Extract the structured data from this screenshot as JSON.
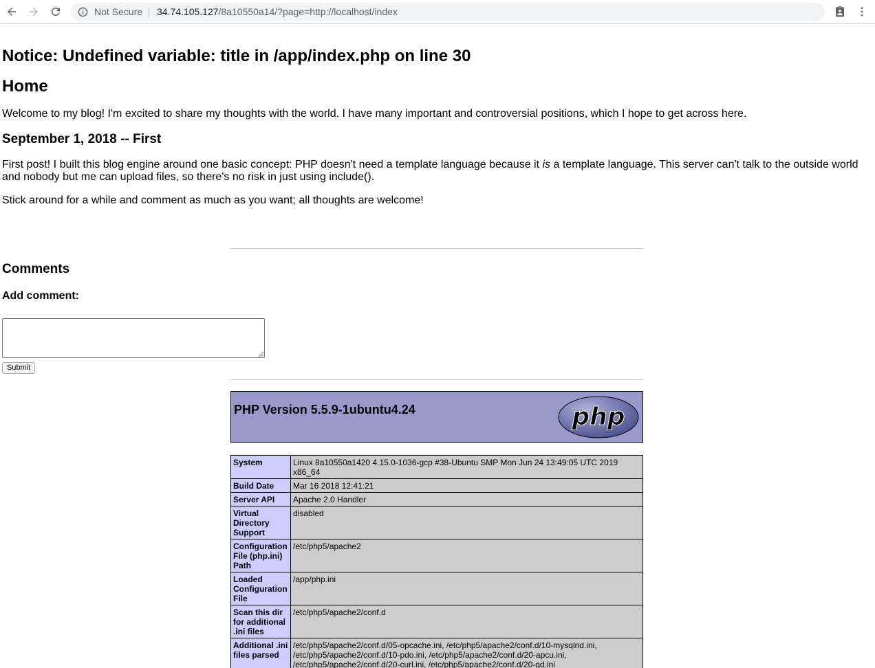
{
  "browser": {
    "security_label": "Not Secure",
    "url_host": "34.74.105.127",
    "url_path": "/8a10550a14/?page=http://localhost/index"
  },
  "page": {
    "notice": "Notice: Undefined variable: title in /app/index.php on line 30",
    "heading": "Home",
    "intro": "Welcome to my blog! I'm excited to share my thoughts with the world. I have many important and controversial positions, which I hope to get across here.",
    "post_title": "September 1, 2018 -- First",
    "post_body_before": "First post! I built this blog engine around one basic concept: PHP doesn't need a template language because it ",
    "post_body_em": "is",
    "post_body_after": " a template language. This server can't talk to the outside world and nobody but me can upload files, so there's no risk in just using include().",
    "post_body_2": "Stick around for a while and comment as much as you want; all thoughts are welcome!",
    "comments_heading": "Comments",
    "add_comment_label": "Add comment:",
    "comment_value": "",
    "submit_label": "Submit"
  },
  "phpinfo": {
    "version": "PHP Version 5.5.9-1ubuntu4.24",
    "logo_text": "php",
    "rows": [
      {
        "key": "System",
        "value": "Linux 8a10550a1420 4.15.0-1036-gcp #38-Ubuntu SMP Mon Jun 24 13:49:05 UTC 2019 x86_64"
      },
      {
        "key": "Build Date",
        "value": "Mar 16 2018 12:41:21"
      },
      {
        "key": "Server API",
        "value": "Apache 2.0 Handler"
      },
      {
        "key": "Virtual Directory Support",
        "value": "disabled"
      },
      {
        "key": "Configuration File (php.ini) Path",
        "value": "/etc/php5/apache2"
      },
      {
        "key": "Loaded Configuration File",
        "value": "/app/php.ini"
      },
      {
        "key": "Scan this dir for additional .ini files",
        "value": "/etc/php5/apache2/conf.d"
      },
      {
        "key": "Additional .ini files parsed",
        "value": "/etc/php5/apache2/conf.d/05-opcache.ini, /etc/php5/apache2/conf.d/10-mysqlnd.ini, /etc/php5/apache2/conf.d/10-pdo.ini, /etc/php5/apache2/conf.d/20-apcu.ini, /etc/php5/apache2/conf.d/20-curl.ini, /etc/php5/apache2/conf.d/20-gd.ini"
      }
    ]
  },
  "colors": {
    "php_header_bg": "#9999cc",
    "key_cell_bg": "#ccccff",
    "value_cell_bg": "#cccccc"
  }
}
